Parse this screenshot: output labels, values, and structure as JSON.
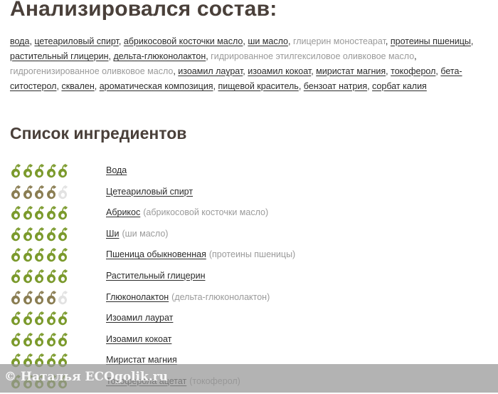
{
  "composition": {
    "title": "Анализировался состав:",
    "items": [
      {
        "text": "вода",
        "linked": true
      },
      {
        "text": "цетеариловый спирт",
        "linked": true
      },
      {
        "text": "абрикосовой косточки масло",
        "linked": true
      },
      {
        "text": "ши масло",
        "linked": true
      },
      {
        "text": "глицерин моностеарат",
        "linked": false
      },
      {
        "text": "протеины пшеницы",
        "linked": true
      },
      {
        "text": "растительный глицерин",
        "linked": true
      },
      {
        "text": "дельта-глюконолактон",
        "linked": true
      },
      {
        "text": "гидрированное этилгексиловое оливковое масло",
        "linked": false
      },
      {
        "text": "гидрогенизированное оливковое масло",
        "linked": false
      },
      {
        "text": "изоамил лаурат",
        "linked": true
      },
      {
        "text": "изоамил кокоат",
        "linked": true
      },
      {
        "text": "миристат магния",
        "linked": true
      },
      {
        "text": "токоферол",
        "linked": true
      },
      {
        "text": "бета-ситостерол",
        "linked": true
      },
      {
        "text": "сквален",
        "linked": true
      },
      {
        "text": "ароматическая композиция",
        "linked": true
      },
      {
        "text": "пищевой краситель",
        "linked": true
      },
      {
        "text": "бензоат натрия",
        "linked": true
      },
      {
        "text": "сорбат калия",
        "linked": true
      }
    ]
  },
  "ingredients_list": {
    "title": "Список ингредиентов",
    "max_rating": 5,
    "colors": {
      "green": "#7b9a2c",
      "olive": "#8a7d52",
      "empty": "#e2e2e2"
    },
    "items": [
      {
        "name": "Вода",
        "alias": "",
        "rating": 5,
        "tone": "green"
      },
      {
        "name": "Цетеариловый спирт",
        "alias": "",
        "rating": 4,
        "tone": "olive"
      },
      {
        "name": "Абрикос",
        "alias": "(абрикосовой косточки масло)",
        "rating": 5,
        "tone": "green"
      },
      {
        "name": "Ши",
        "alias": "(ши масло)",
        "rating": 5,
        "tone": "green"
      },
      {
        "name": "Пшеница обыкновенная",
        "alias": "(протеины пшеницы)",
        "rating": 5,
        "tone": "green"
      },
      {
        "name": "Растительный глицерин",
        "alias": "",
        "rating": 5,
        "tone": "green"
      },
      {
        "name": "Глюконолактон",
        "alias": "(дельта-глюконолактон)",
        "rating": 4,
        "tone": "olive"
      },
      {
        "name": "Изоамил лаурат",
        "alias": "",
        "rating": 5,
        "tone": "green"
      },
      {
        "name": "Изоамил кокоат",
        "alias": "",
        "rating": 5,
        "tone": "green"
      },
      {
        "name": "Миристат магния",
        "alias": "",
        "rating": 5,
        "tone": "green"
      },
      {
        "name": "Токоферола ацетат",
        "alias": "(токоферол)",
        "rating": 5,
        "tone": "green"
      }
    ]
  },
  "watermark": {
    "text": "© Наталья  ECOgolik.ru"
  }
}
